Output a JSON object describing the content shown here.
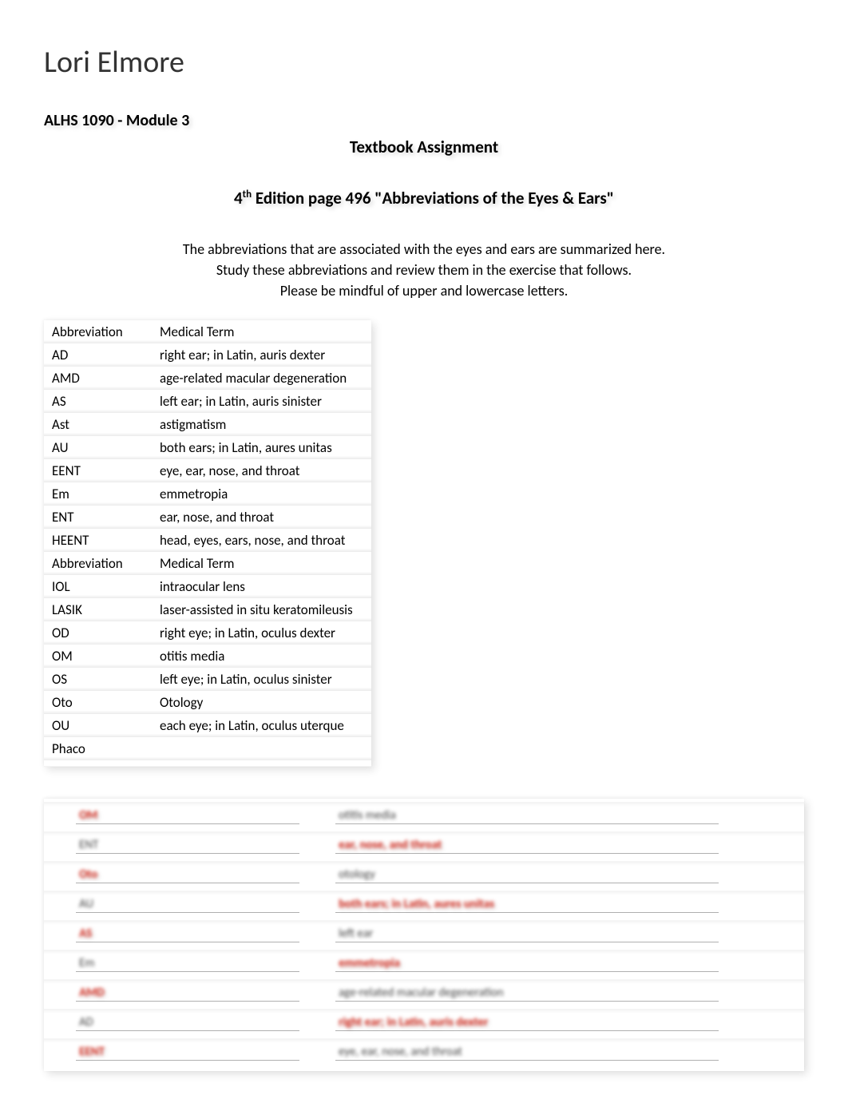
{
  "author": "Lori Elmore",
  "course": "ALHS 1090 - Module 3",
  "assignmentTitle": "Textbook Assignment",
  "editionPrefix": "4",
  "editionSuffix": "th",
  "editionRest": " Edition page 496 \"Abbreviations of the Eyes & Ears\"",
  "intro1": "The abbreviations that are associated with the eyes and ears are summarized here.",
  "intro2": "Study these abbreviations and review them in the exercise that follows.",
  "intro3": "Please be mindful of upper and lowercase letters.",
  "abbrevHeader1": "Abbreviation",
  "abbrevHeader2": "Medical Term",
  "abbreviations": [
    {
      "abbr": "AD",
      "term": "right ear; in Latin, auris dexter"
    },
    {
      "abbr": "AMD",
      "term": "age-related macular degeneration"
    },
    {
      "abbr": "AS",
      "term": "left ear; in Latin, auris sinister"
    },
    {
      "abbr": "Ast",
      "term": "astigmatism"
    },
    {
      "abbr": "AU",
      "term": "both ears; in Latin, aures unitas"
    },
    {
      "abbr": "EENT",
      "term": "eye, ear, nose, and throat"
    },
    {
      "abbr": "Em",
      "term": "emmetropia"
    },
    {
      "abbr": "ENT",
      "term": "ear, nose, and throat"
    },
    {
      "abbr": "HEENT",
      "term": "head, eyes, ears, nose, and throat"
    },
    {
      "abbr": "Abbreviation",
      "term": "Medical Term"
    },
    {
      "abbr": "IOL",
      "term": "intraocular lens"
    },
    {
      "abbr": "LASIK",
      "term": "laser-assisted in situ keratomileusis"
    },
    {
      "abbr": "OD",
      "term": "right eye; in Latin, oculus dexter"
    },
    {
      "abbr": "OM",
      "term": "otitis media"
    },
    {
      "abbr": "OS",
      "term": "left eye; in Latin, oculus sinister"
    },
    {
      "abbr": "Oto",
      "term": "Otology"
    },
    {
      "abbr": "OU",
      "term": "each eye; in Latin, oculus uterque"
    },
    {
      "abbr": "Phaco",
      "term": ""
    },
    {
      "abbr": "",
      "term": ""
    }
  ],
  "exercise": [
    {
      "num": "",
      "left": "OM",
      "leftRed": true,
      "right": "otitis media",
      "rightRed": false
    },
    {
      "num": "",
      "left": "ENT",
      "leftRed": false,
      "right": "ear, nose, and throat",
      "rightRed": true
    },
    {
      "num": "",
      "left": "Oto",
      "leftRed": true,
      "right": "otology",
      "rightRed": false
    },
    {
      "num": "",
      "left": "AU",
      "leftRed": false,
      "right": "both ears; in Latin, aures unitas",
      "rightRed": true
    },
    {
      "num": "",
      "left": "AS",
      "leftRed": true,
      "right": "left ear",
      "rightRed": false
    },
    {
      "num": "",
      "left": "Em",
      "leftRed": false,
      "right": "emmetropia",
      "rightRed": true
    },
    {
      "num": "",
      "left": "AMD",
      "leftRed": true,
      "right": "age-related macular degeneration",
      "rightRed": false
    },
    {
      "num": "",
      "left": "AD",
      "leftRed": false,
      "right": "right ear; in Latin, auris dexter",
      "rightRed": true
    },
    {
      "num": "",
      "left": "EENT",
      "leftRed": true,
      "right": "eye, ear, nose, and throat",
      "rightRed": false
    }
  ]
}
